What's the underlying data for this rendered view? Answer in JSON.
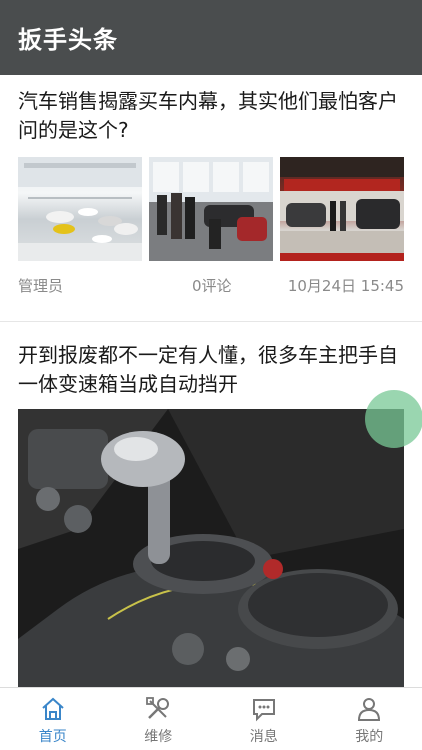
{
  "header": {
    "title": "扳手头条"
  },
  "articles": [
    {
      "headline": "汽车销售揭露买车内幕，其实他们最怕客户问的是这个?",
      "author": "管理员",
      "comments": "0评论",
      "time": "10月24日 15:45"
    },
    {
      "headline": "开到报废都不一定有人懂，很多车主把手自一体变速箱当成自动挡开"
    }
  ],
  "tabs": [
    {
      "label": "首页",
      "icon": "home-icon",
      "active": true
    },
    {
      "label": "维修",
      "icon": "tools-icon",
      "active": false
    },
    {
      "label": "消息",
      "icon": "message-icon",
      "active": false
    },
    {
      "label": "我的",
      "icon": "user-icon",
      "active": false
    }
  ],
  "colors": {
    "header_bg": "#4a4d4e",
    "active_tab": "#3a86c9",
    "fab": "#78c896"
  }
}
